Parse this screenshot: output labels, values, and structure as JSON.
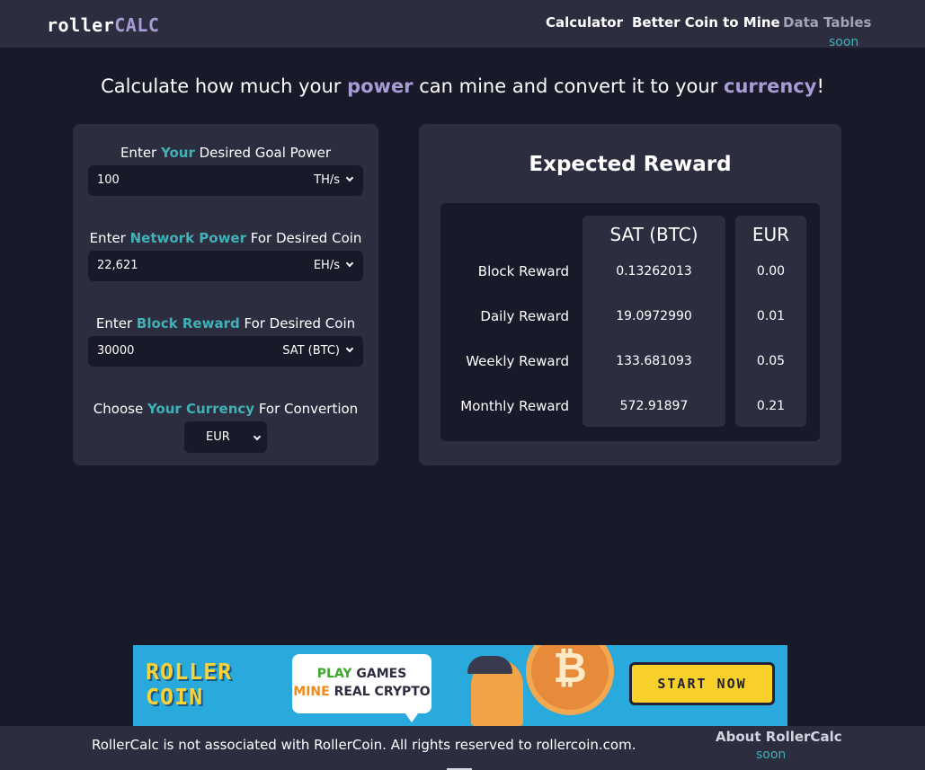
{
  "header": {
    "logo_part1": "roller",
    "logo_part2": "CALC",
    "nav": [
      {
        "label": "Calculator"
      },
      {
        "label": "Better Coin to Mine"
      },
      {
        "label": "Data Tables"
      }
    ],
    "data_tables_badge": "soon"
  },
  "headline": {
    "part1": "Calculate how much your ",
    "highlight1": "power",
    "part2": " can mine and convert it to your ",
    "highlight2": "currency",
    "part3": "!"
  },
  "form": {
    "goal_power": {
      "label_pre": "Enter ",
      "label_hl": "Your",
      "label_post": " Desired Goal Power",
      "value": "100",
      "unit": "TH/s"
    },
    "network_power": {
      "label_pre": "Enter ",
      "label_hl": "Network Power",
      "label_post": " For Desired Coin",
      "value": "22,621",
      "unit": "EH/s"
    },
    "block_reward": {
      "label_pre": "Enter ",
      "label_hl": "Block Reward",
      "label_post": " For Desired Coin",
      "value": "30000",
      "unit": "SAT (BTC)"
    },
    "currency": {
      "label_pre": "Choose ",
      "label_hl": "Your Currency",
      "label_post": " For Convertion",
      "value": "EUR"
    }
  },
  "reward": {
    "title": "Expected Reward",
    "columns": [
      "SAT (BTC)",
      "EUR"
    ],
    "rows": [
      {
        "label": "Block Reward",
        "btc": "0.13262013",
        "eur": "0.00"
      },
      {
        "label": "Daily Reward",
        "btc": "19.0972990",
        "eur": "0.01"
      },
      {
        "label": "Weekly Reward",
        "btc": "133.681093",
        "eur": "0.05"
      },
      {
        "label": "Monthly Reward",
        "btc": "572.91897",
        "eur": "0.21"
      }
    ]
  },
  "banner": {
    "logo_line1": "ROLLER",
    "logo_line2": "COIN",
    "play": "PLAY",
    "games": " GAMES",
    "mine": "MINE",
    "real_crypto": " REAL CRYPTO",
    "coin_symbol": "₿",
    "cta": "START NOW"
  },
  "footer": {
    "disclaimer": "RollerCalc is not associated with RollerCoin. All rights reserved to rollercoin.com.",
    "about": "About RollerCalc",
    "about_badge": "soon"
  },
  "colors": {
    "background": "#191a29",
    "panel": "#2d2d40",
    "accent_teal": "#3fb1b7",
    "accent_purple": "#a89bd6"
  }
}
